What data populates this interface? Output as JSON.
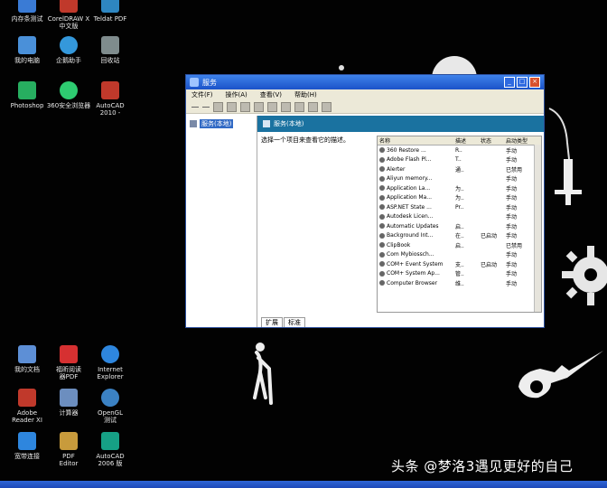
{
  "desktop_icons": [
    {
      "label": "内存条测试",
      "color": "#3a7bd5"
    },
    {
      "label": "CorelDRAW X\n中文版",
      "color": "#c0392b"
    },
    {
      "label": "Teldat PDF",
      "color": "#2e86c1"
    },
    {
      "label": "我的电脑",
      "color": "#4a90d9"
    },
    {
      "label": "企鹅助手",
      "color": "#3498db"
    },
    {
      "label": "回收站",
      "color": "#7f8c8d"
    },
    {
      "label": "Photoshop",
      "color": "#27ae60"
    },
    {
      "label": "360安全浏览器",
      "color": "#2ecc71"
    },
    {
      "label": "AutoCAD\n2010 -",
      "color": "#c0392b"
    },
    {
      "label": "我的文档",
      "color": "#5d8fd6"
    },
    {
      "label": "福昕阅读\n器PDF",
      "color": "#d63031"
    },
    {
      "label": "Internet\nExplorer",
      "color": "#2e86de"
    },
    {
      "label": "Adobe\nReader XI",
      "color": "#c0392b"
    },
    {
      "label": "计算器",
      "color": "#6c8ebf"
    },
    {
      "label": "OpenGL\n测试",
      "color": "#3b82c4"
    },
    {
      "label": "宽带连接",
      "color": "#2e86de"
    },
    {
      "label": "PDF\nEditor",
      "color": "#c89b3c"
    },
    {
      "label": "AutoCAD\n2006 版",
      "color": "#16a085"
    }
  ],
  "window": {
    "title": "服务",
    "menu": [
      "文件(F)",
      "操作(A)",
      "查看(V)",
      "帮助(H)"
    ],
    "tree_node": "服务(本地)",
    "header_title": "服务(本地)",
    "description": "选择一个项目来查看它的描述。",
    "columns": [
      "名称",
      "描述",
      "状态",
      "启动类型"
    ],
    "services": [
      {
        "name": "360 Restore ...",
        "desc": "R..",
        "status": "",
        "startup": "手动"
      },
      {
        "name": "Adobe Flash Pl...",
        "desc": "T..",
        "status": "",
        "startup": "手动"
      },
      {
        "name": "Alerter",
        "desc": "通..",
        "status": "",
        "startup": "已禁用"
      },
      {
        "name": "Aliyun memory...",
        "desc": "",
        "status": "",
        "startup": "手动"
      },
      {
        "name": "Application La...",
        "desc": "为..",
        "status": "",
        "startup": "手动"
      },
      {
        "name": "Application Ma...",
        "desc": "为..",
        "status": "",
        "startup": "手动"
      },
      {
        "name": "ASP.NET State ...",
        "desc": "Pr..",
        "status": "",
        "startup": "手动"
      },
      {
        "name": "Autodesk Licen...",
        "desc": "",
        "status": "",
        "startup": "手动"
      },
      {
        "name": "Automatic Updates",
        "desc": "启..",
        "status": "",
        "startup": "手动"
      },
      {
        "name": "Background Int...",
        "desc": "在..",
        "status": "已启动",
        "startup": "手动"
      },
      {
        "name": "ClipBook",
        "desc": "启..",
        "status": "",
        "startup": "已禁用"
      },
      {
        "name": "Com Mybiossch...",
        "desc": "",
        "status": "",
        "startup": "手动"
      },
      {
        "name": "COM+ Event System",
        "desc": "支..",
        "status": "已启动",
        "startup": "手动"
      },
      {
        "name": "COM+ System Ap...",
        "desc": "管..",
        "status": "",
        "startup": "手动"
      },
      {
        "name": "Computer Browser",
        "desc": "维..",
        "status": "",
        "startup": "手动"
      }
    ],
    "tabs": [
      "扩展",
      "标准"
    ]
  },
  "watermark": "头条 @梦洛3遇见更好的自己"
}
